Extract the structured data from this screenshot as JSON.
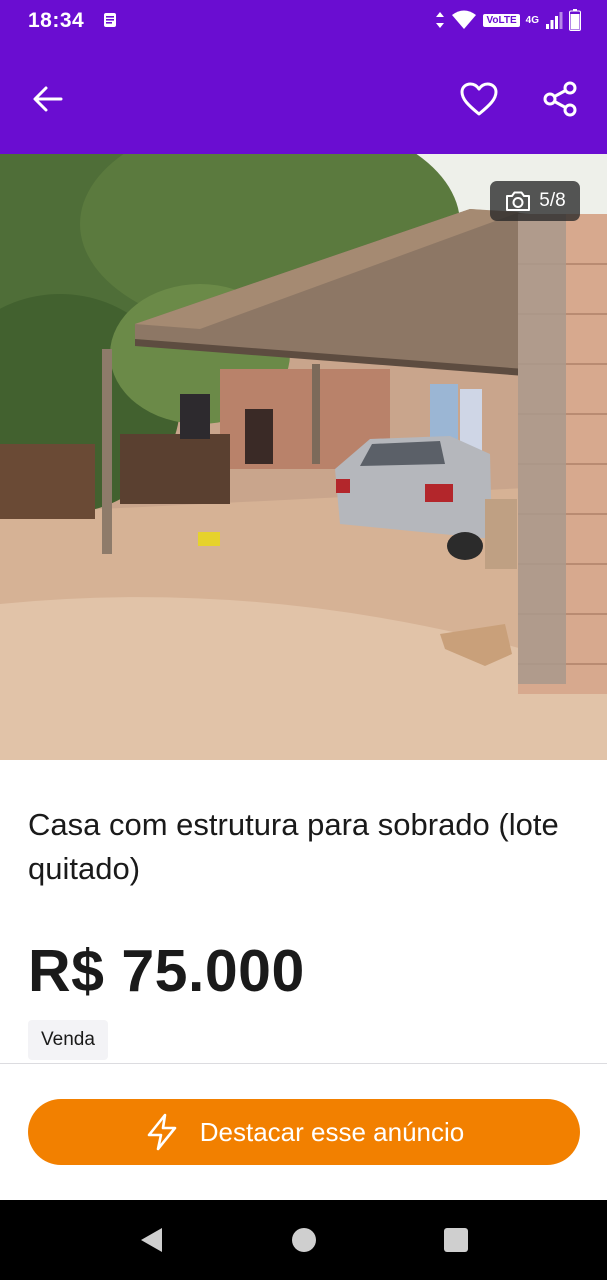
{
  "status_bar": {
    "time": "18:34",
    "volte": "VoLTE",
    "network": "4G"
  },
  "photo": {
    "counter": "5/8"
  },
  "listing": {
    "title": "Casa com estrutura para sobrado (lote quitado)",
    "price": "R$ 75.000",
    "tag": "Venda"
  },
  "cta": {
    "label": "Destacar esse anúncio"
  },
  "colors": {
    "brand_purple": "#6a0dd1",
    "accent_orange": "#f28000",
    "text": "#1a1a1a"
  },
  "icons": [
    "back-arrow-icon",
    "heart-icon",
    "share-icon",
    "camera-icon",
    "lightning-icon"
  ]
}
